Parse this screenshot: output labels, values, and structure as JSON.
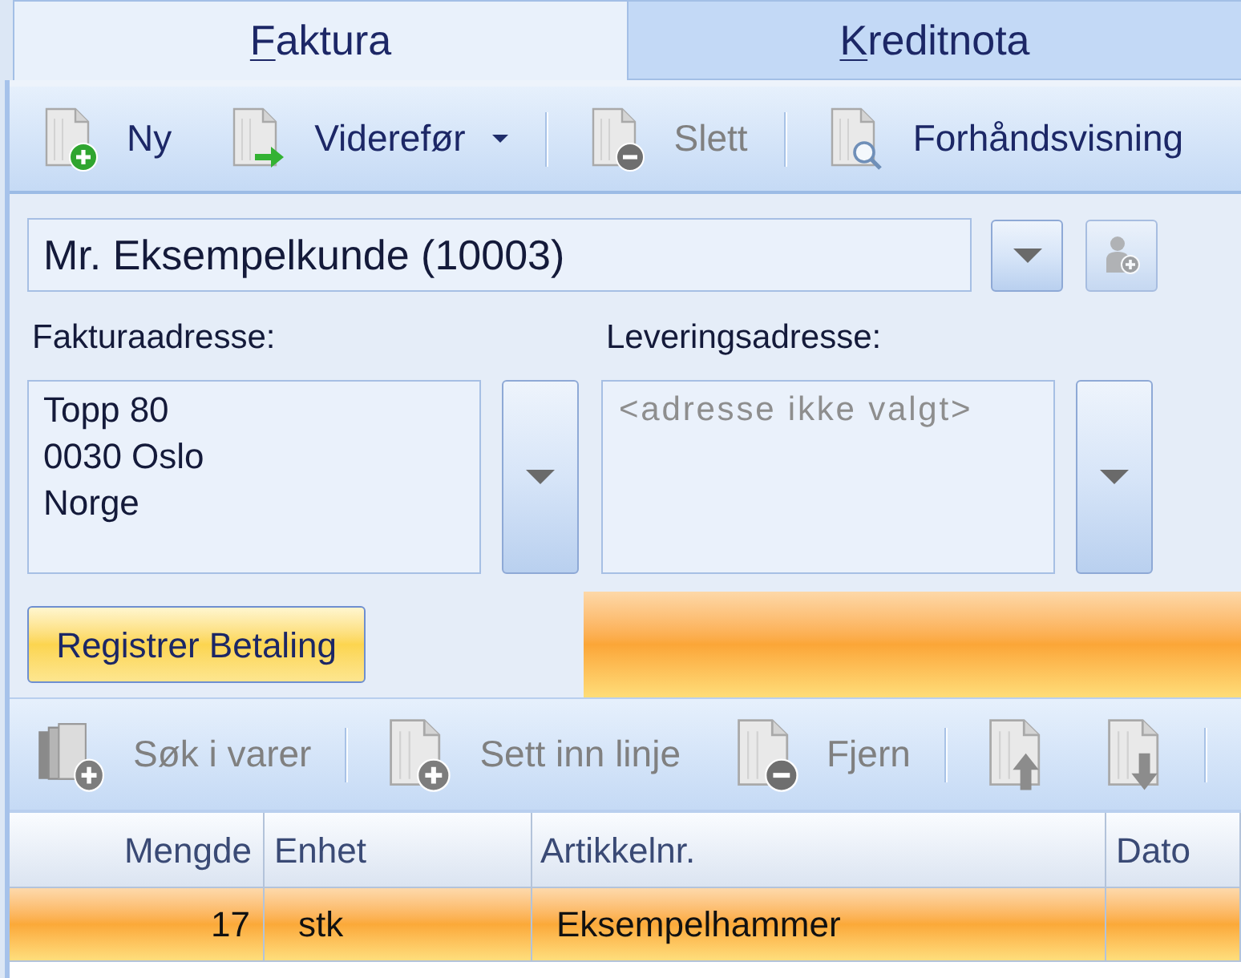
{
  "tabs": [
    {
      "label": "Faktura",
      "selected": true,
      "access_key_shown": true
    },
    {
      "label": "Kreditnota",
      "selected": false,
      "access_key_shown": true
    }
  ],
  "toolbar": {
    "items": [
      {
        "kind": "button",
        "label": "Ny",
        "disabled": false
      },
      {
        "kind": "split",
        "label": "Viderefør",
        "disabled": false
      },
      {
        "kind": "separator"
      },
      {
        "kind": "button",
        "label": "Slett",
        "disabled": true
      },
      {
        "kind": "separator"
      },
      {
        "kind": "button",
        "label": "Forhåndsvisning",
        "disabled": false
      }
    ]
  },
  "customer": {
    "value": "Mr. Eksempelkunde (10003)",
    "add_disabled": true
  },
  "invoice_address": {
    "label": "Fakturaadresse:",
    "lines": [
      "Topp 80",
      "0030 Oslo",
      "Norge"
    ]
  },
  "delivery_address": {
    "label": "Leveringsadresse:",
    "placeholder": "<adresse ikke valgt>"
  },
  "payment_button": {
    "label": "Registrer Betaling"
  },
  "lines_toolbar": {
    "items": [
      {
        "kind": "button",
        "label": "Søk i varer",
        "disabled": true
      },
      {
        "kind": "separator"
      },
      {
        "kind": "button",
        "label": "Sett inn linje",
        "disabled": true
      },
      {
        "kind": "button",
        "label": "Fjern",
        "disabled": true
      },
      {
        "kind": "separator"
      },
      {
        "kind": "icon-button",
        "disabled": true
      },
      {
        "kind": "icon-button",
        "disabled": true
      },
      {
        "kind": "separator"
      }
    ]
  },
  "table": {
    "columns": [
      "Mengde",
      "Enhet",
      "Artikkelnr.",
      "Dato"
    ],
    "rows": [
      {
        "selected": true,
        "cells": [
          "17",
          "stk",
          "Eksempelhammer"
        ]
      }
    ]
  }
}
